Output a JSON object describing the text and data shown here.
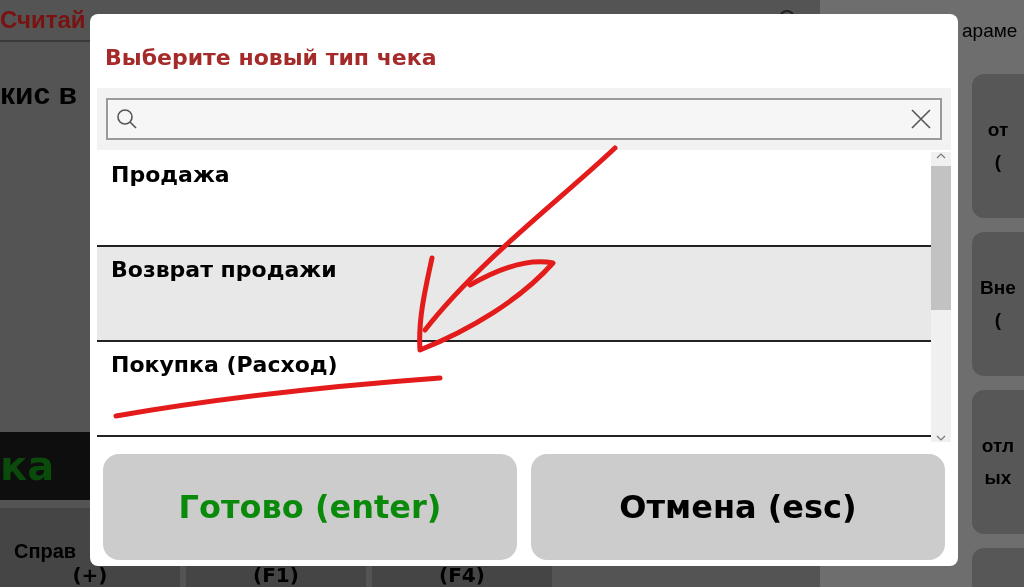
{
  "background": {
    "title": "Считай",
    "subtitle": "кис в",
    "banner": "ка",
    "side_header": "араме",
    "bottom_buttons": [
      {
        "lines": [
          "Справ",
          "(+)"
        ]
      },
      {
        "lines": [
          "(F1)"
        ]
      },
      {
        "lines": [
          "(F4)"
        ]
      }
    ],
    "side_buttons": [
      {
        "lines": [
          "от",
          "("
        ]
      },
      {
        "lines": [
          "Вне",
          "("
        ]
      },
      {
        "lines": [
          "отл",
          "ых"
        ]
      }
    ]
  },
  "dialog": {
    "title": "Выберите новый тип чека",
    "items": [
      {
        "label": "Продажа",
        "selected": false
      },
      {
        "label": "Возврат продажи",
        "selected": true
      },
      {
        "label": "Покупка (Расход)",
        "selected": false
      }
    ],
    "buttons": [
      {
        "label": "Готово (enter)",
        "kind": "confirm"
      },
      {
        "label": "Отмена (esc)",
        "kind": "cancel"
      }
    ]
  }
}
